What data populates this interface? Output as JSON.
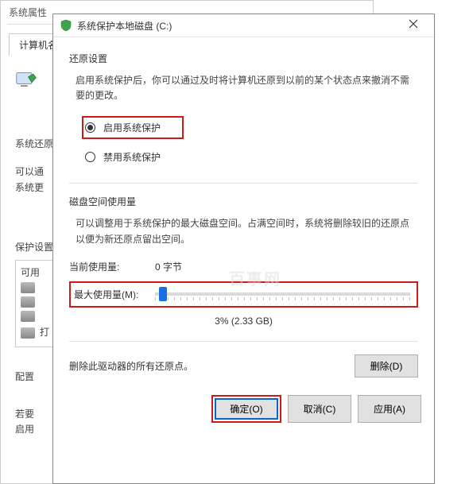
{
  "bg": {
    "title": "系统属性",
    "tab": "计算机名",
    "section1_label": "系统还原",
    "section1_line1": "可以通",
    "section1_line2": "系统更",
    "section2_label": "保护设置",
    "list_header": "可用",
    "config_label": "配置",
    "need_label": "若要",
    "enable_label": "启用"
  },
  "dialog": {
    "title": "系统保护本地磁盘 (C:)",
    "restore_head": "还原设置",
    "restore_desc": "启用系统保护后，你可以通过及时将计算机还原到以前的某个状态点来撤消不需要的更改。",
    "radio_on": "启用系统保护",
    "radio_off": "禁用系统保护",
    "disk_head": "磁盘空间使用量",
    "disk_desc": "可以调整用于系统保护的最大磁盘空间。占满空间时，系统将删除较旧的还原点以便为新还原点留出空间。",
    "current_label": "当前使用量:",
    "current_value": "0 字节",
    "max_label": "最大使用量(M):",
    "slider_readout": "3% (2.33 GB)",
    "delete_text": "删除此驱动器的所有还原点。",
    "delete_btn": "删除(D)",
    "ok_btn": "确定(O)",
    "cancel_btn": "取消(C)",
    "apply_btn": "应用(A)"
  },
  "watermark": "百事网"
}
